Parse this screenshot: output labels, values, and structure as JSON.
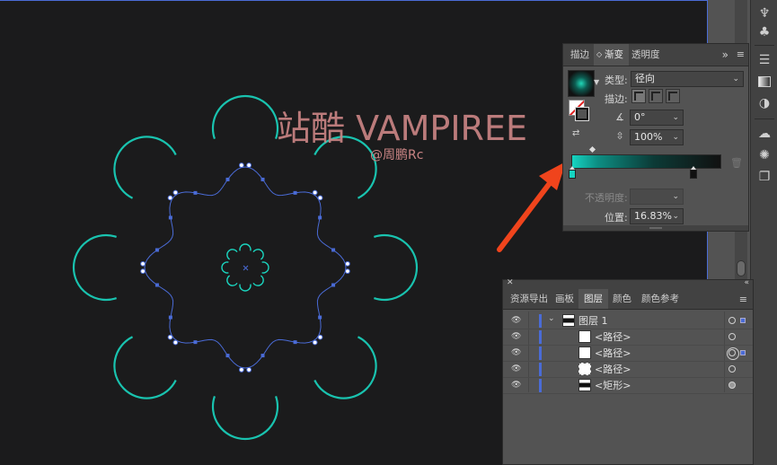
{
  "canvas": {
    "watermark_title": "站酷 VAMPIREE",
    "watermark_sub": "@周鹏Rc"
  },
  "colors": {
    "artboard_bg": "#1b1b1c",
    "teal": "#1ad6c0",
    "path_blue": "#4a6bd6",
    "arrow_red": "#f0441c",
    "watermark": "#c98484"
  },
  "gradient_panel": {
    "tabs": [
      {
        "label": "描边",
        "active": false
      },
      {
        "label": "渐变",
        "active": true
      },
      {
        "label": "透明度",
        "active": false
      }
    ],
    "type_label": "类型:",
    "type_value": "径向",
    "stroke_label": "描边:",
    "angle_value": "0°",
    "aspect_value": "100%",
    "opacity_label": "不透明度:",
    "opacity_value": "",
    "location_label": "位置:",
    "location_value": "16.83%",
    "gradient_stops": [
      {
        "color": "#16d4c1",
        "position": 0
      },
      {
        "color": "#111111",
        "position": 100
      }
    ],
    "midpoint_position": 16.83,
    "icons": [
      "gradient-swatch-icon",
      "fill-stroke-icon",
      "reverse-gradient-icon",
      "angle-icon",
      "aspect-ratio-icon",
      "delete-stop-icon",
      "panel-menu-icon",
      "collapse-icon"
    ]
  },
  "layers_panel": {
    "tabs": [
      {
        "label": "资源导出",
        "active": false
      },
      {
        "label": "画板",
        "active": false
      },
      {
        "label": "图层",
        "active": true
      },
      {
        "label": "颜色",
        "active": false
      },
      {
        "label": "颜色参考",
        "active": false
      }
    ],
    "layers": [
      {
        "name": "图层 1",
        "level": 0,
        "expanded": true,
        "target": "single",
        "selected": true
      },
      {
        "name": "<路径>",
        "level": 1,
        "target": "single",
        "selected": false
      },
      {
        "name": "<路径>",
        "level": 1,
        "target": "double",
        "selected": true
      },
      {
        "name": "<路径>",
        "level": 1,
        "target": "single",
        "selected": false
      },
      {
        "name": "<矩形>",
        "level": 1,
        "target": "filled",
        "selected": false
      }
    ]
  },
  "right_toolbar": {
    "icons": [
      "puppet-icon",
      "club-icon",
      "properties-icon",
      "gradient-icon",
      "transparency-icon",
      "cc-libraries-icon",
      "appearance-icon",
      "graphic-styles-icon"
    ]
  }
}
